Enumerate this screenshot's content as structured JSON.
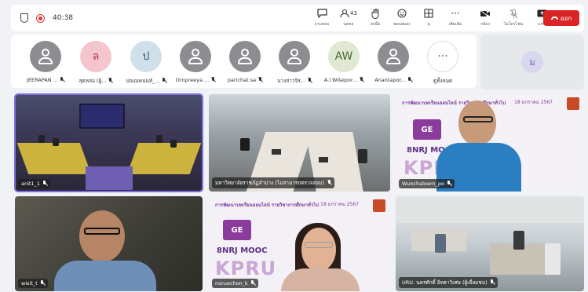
{
  "toolbar": {
    "timer": "40:38",
    "buttons": [
      {
        "id": "chat",
        "label": "ถามตอบ"
      },
      {
        "id": "people",
        "label": "บุคคล",
        "count": "43"
      },
      {
        "id": "raise",
        "label": "ยกมือ"
      },
      {
        "id": "react",
        "label": "ตอบสนอง"
      },
      {
        "id": "view",
        "label": "มุ"
      },
      {
        "id": "more",
        "label": "เพิ่มเติม"
      }
    ],
    "right_buttons": [
      {
        "id": "camera",
        "label": "กล้อง"
      },
      {
        "id": "mic",
        "label": "ไมโครโฟน"
      },
      {
        "id": "share",
        "label": "แชร์"
      }
    ],
    "leave_label": "ออก"
  },
  "participants": [
    {
      "name": "JEERAPAN ...",
      "initial": "",
      "style": "grey"
    },
    {
      "name": "สุดหล่อ (ผู้...",
      "initial": "ล",
      "style": "pink"
    },
    {
      "name": "ปณณพนนท์_...",
      "initial": "ป",
      "style": "blue"
    },
    {
      "name": "Ornpreeya ...",
      "initial": "",
      "style": "grey"
    },
    {
      "name": "parichat.sa",
      "initial": "",
      "style": "grey"
    },
    {
      "name": "นางสาวจิร...",
      "initial": "",
      "style": "grey"
    },
    {
      "name": "A.l.Wilaipor...",
      "initial": "AW",
      "style": "green"
    },
    {
      "name": "Anantapor...",
      "initial": "",
      "style": "grey"
    },
    {
      "name": "ดูทั้งหมด",
      "initial": "···",
      "style": "more"
    }
  ],
  "side_panel": {
    "initial": "ม"
  },
  "videos": [
    {
      "name": "anit1_1"
    },
    {
      "name": "มหาวิทยาลัยราชภัฏลำปาง (ไม่สามารถตรวจสอบ)"
    },
    {
      "name": "Wunchaloern_po"
    },
    {
      "name": "wisit_t"
    },
    {
      "name": "noruechon_k"
    },
    {
      "name": "URU. นครศักดิ์ อิทธาวิเศษ (ผู้เยี่ยมชม)"
    }
  ],
  "banner": {
    "headline": "การพัฒนาบทเรียนออนไลน์ รายวิชาการศึกษาทั่วไป",
    "date": "18 มกราคม 2567",
    "ge": "GE",
    "mooc": "8NRJ MOOC",
    "kpru": "KPRU"
  },
  "colors": {
    "accent": "#7b6ee0",
    "leave": "#d92525"
  }
}
